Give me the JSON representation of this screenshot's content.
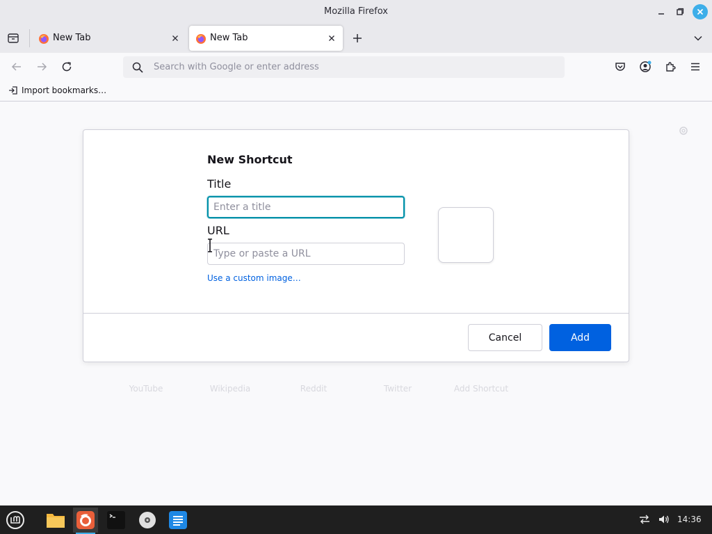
{
  "window": {
    "title": "Mozilla Firefox"
  },
  "tabs": [
    {
      "label": "New Tab",
      "active": false
    },
    {
      "label": "New Tab",
      "active": true
    }
  ],
  "navbar": {
    "url_placeholder": "Search with Google or enter address"
  },
  "bookmarks": {
    "import_label": "Import bookmarks…"
  },
  "background_tiles": [
    "YouTube",
    "Wikipedia",
    "Reddit",
    "Twitter",
    "Add Shortcut"
  ],
  "dialog": {
    "heading": "New Shortcut",
    "title_label": "Title",
    "title_placeholder": "Enter a title",
    "url_label": "URL",
    "url_placeholder": "Type or paste a URL",
    "custom_image_link": "Use a custom image…",
    "cancel_label": "Cancel",
    "add_label": "Add"
  },
  "taskbar": {
    "apps": [
      "menu-icon",
      "files-icon",
      "firefox-icon",
      "terminal-icon",
      "disc-icon",
      "text-editor-icon"
    ],
    "clock": "14:36"
  },
  "colors": {
    "accent": "#0061e0",
    "focus_ring": "#0090a8",
    "taskbar_bg": "#1f1f1f",
    "close_button": "#3daee9"
  }
}
